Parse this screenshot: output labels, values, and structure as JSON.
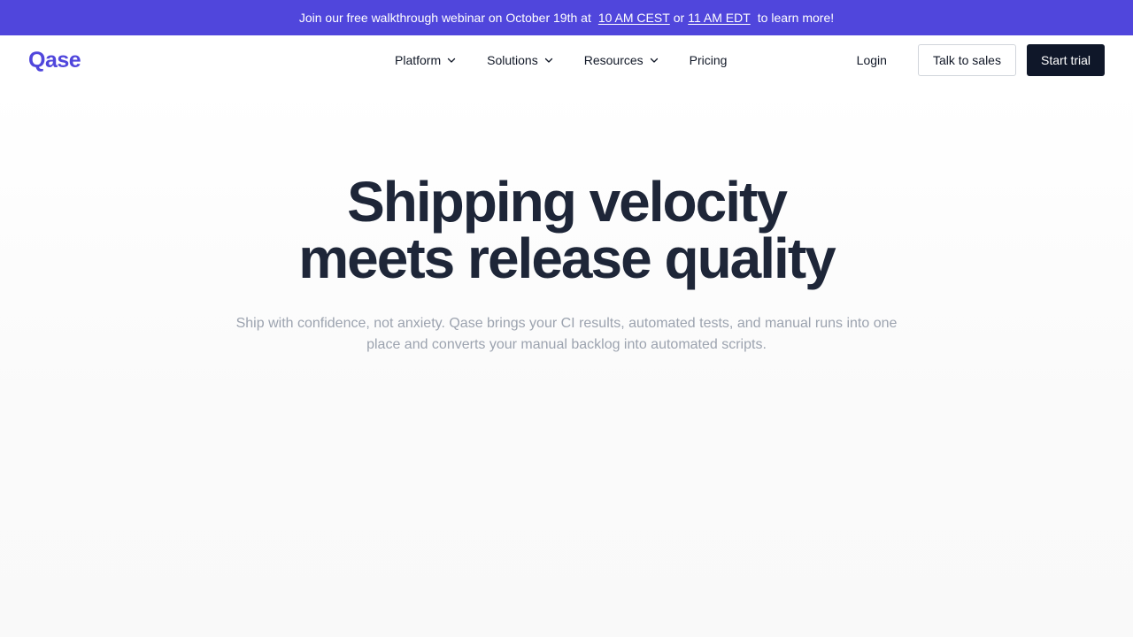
{
  "banner": {
    "text_before": "Join our free walkthrough webinar on October 19th at",
    "link_cest": "10 AM CEST",
    "text_or": "or",
    "link_edt": "11 AM EDT",
    "text_after": "to learn more!"
  },
  "header": {
    "logo": "Qase",
    "nav": [
      {
        "label": "Platform",
        "icon": "chevron-down-icon"
      },
      {
        "label": "Solutions",
        "icon": "chevron-down-icon"
      },
      {
        "label": "Resources",
        "icon": "chevron-down-icon"
      },
      {
        "label": "Pricing"
      }
    ],
    "login_label": "Login",
    "sales_label": "Talk to sales",
    "trial_label": "Start trial"
  },
  "hero": {
    "title_line1": "Shipping velocity",
    "title_line2": "meets release quality",
    "subtitle": "Ship with confidence, not anxiety. Qase brings your CI results, automated tests, and manual runs into one place and converts your manual backlog into automated scripts."
  },
  "colors": {
    "brand": "#5046dc",
    "dark": "#0f1729",
    "heading": "#1e2638",
    "muted": "#9ca3af"
  }
}
